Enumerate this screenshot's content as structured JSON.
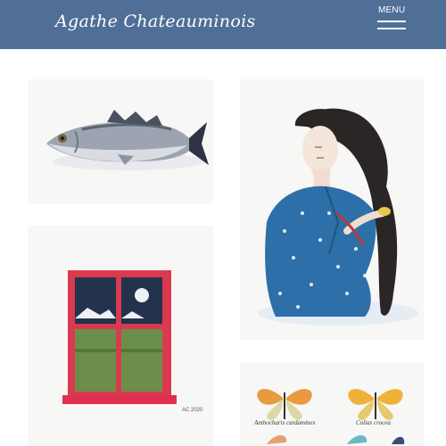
{
  "header": {
    "site_title": "Agathe Chateauminois",
    "menu_label": "MENU",
    "background_color": "#4f6f96"
  },
  "gallery": {
    "artworks": [
      {
        "subject": "fish",
        "icon": "fish-painting"
      },
      {
        "subject": "woman combing hair",
        "icon": "woman-painting"
      },
      {
        "subject": "red window",
        "icon": "window-painting",
        "signature": "AC 2020"
      },
      {
        "subject": "butterflies",
        "icon": "butterflies-painting",
        "captions": [
          "Anthocharis cardamines",
          "Colias crocea"
        ]
      }
    ]
  }
}
